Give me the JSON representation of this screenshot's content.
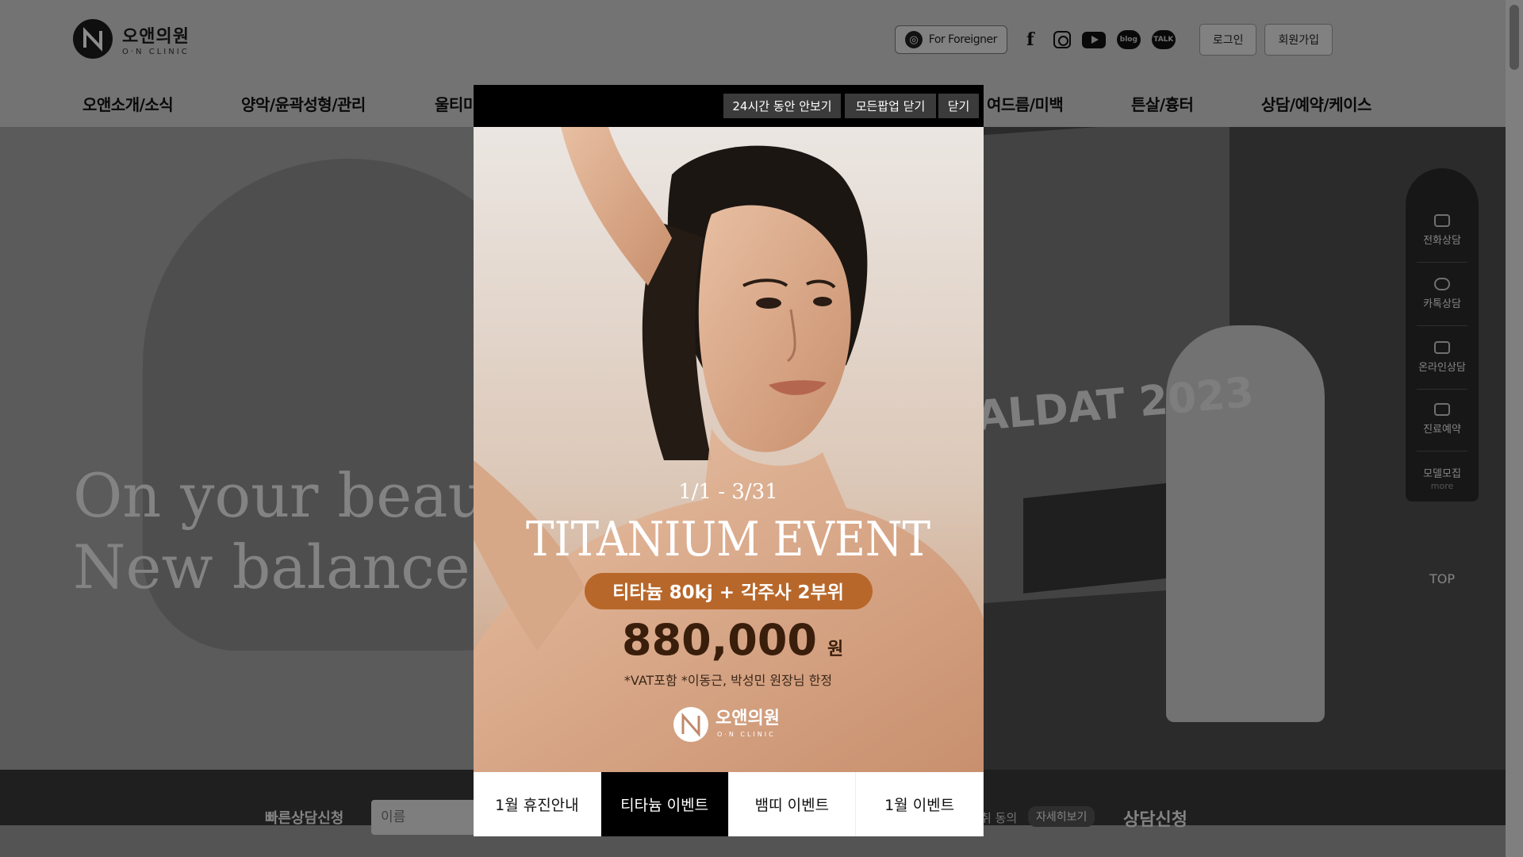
{
  "header": {
    "logo_ko": "오앤의원",
    "logo_en": "O·N CLINIC",
    "foreigner_label": "For Foreigner",
    "login_label": "로그인",
    "signup_label": "회원가입",
    "sns": {
      "blog": "blog",
      "talk": "TALK"
    },
    "nav": [
      "오앤소개/소식",
      "양악/윤곽성형/관리",
      "울티미",
      "여드름/미백",
      "튼살/흉터",
      "상담/예약/케이스"
    ]
  },
  "hero": {
    "copy_line1": "On your beau",
    "copy_line2": "New balance",
    "banner_text": "ALDAT 2023"
  },
  "quick_consult": {
    "label": "빠른상담신청",
    "name_placeholder": "이름",
    "agree_text": "취 동의",
    "detail_label": "자세히보기",
    "submit_label": "상담신청"
  },
  "quick_menu": {
    "items": [
      "전화상담",
      "카톡상담",
      "온라인상담",
      "진료예약",
      "모델모집"
    ],
    "more": "more",
    "top": "TOP"
  },
  "popup": {
    "hide_24h": "24시간 동안 안보기",
    "close_all": "모든팝업 닫기",
    "close": "닫기",
    "date_range": "1/1 - 3/31",
    "event_title": "TITANIUM EVENT",
    "offer_pill": "티타늄 80kj + 각주사 2부위",
    "price": "880,000",
    "price_unit": "원",
    "note": "*VAT포함  *이동근, 박성민 원장님 한정",
    "brand_ko": "오앤의원",
    "brand_en": "O·N CLINIC",
    "tabs": [
      "1월 휴진안내",
      "티타늄 이벤트",
      "뱀띠 이벤트",
      "1월 이벤트"
    ],
    "active_tab": 1
  },
  "colors": {
    "pill": "#b8672a",
    "price": "#3a1e0c",
    "popup_bar": "#000000"
  }
}
